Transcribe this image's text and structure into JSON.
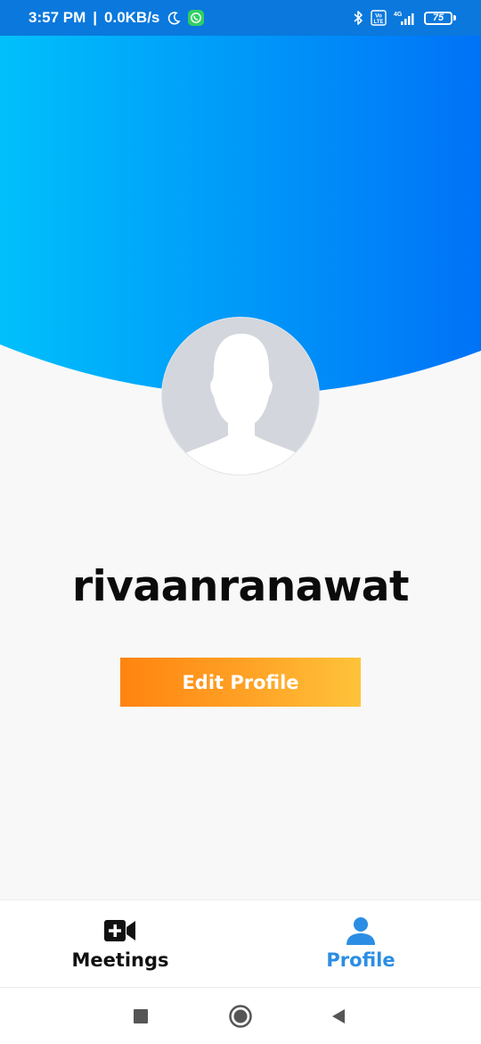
{
  "status_bar": {
    "time": "3:57 PM",
    "separator": "|",
    "network_speed": "0.0KB/s",
    "battery_level": "75",
    "network_type": "4G",
    "volte": "Vo LTE",
    "icons": [
      "moon-icon",
      "whatsapp-icon",
      "bluetooth-icon",
      "volte-icon",
      "signal-icon",
      "battery-icon"
    ]
  },
  "profile": {
    "username": "rivaanranawat",
    "edit_button_label": "Edit Profile",
    "avatar_icon": "default-avatar-icon"
  },
  "colors": {
    "header_gradient_start": "#00c0fb",
    "header_gradient_end": "#0072f7",
    "button_gradient_start": "#ff8410",
    "button_gradient_end": "#ffc33a",
    "active_nav": "#2b8ee4",
    "inactive_nav": "#111111"
  },
  "bottom_nav": {
    "items": [
      {
        "label": "Meetings",
        "icon": "video-add-icon",
        "active": false
      },
      {
        "label": "Profile",
        "icon": "person-icon",
        "active": true
      }
    ]
  },
  "system_nav": {
    "buttons": [
      "recents-square-icon",
      "home-circle-icon",
      "back-triangle-icon"
    ]
  }
}
